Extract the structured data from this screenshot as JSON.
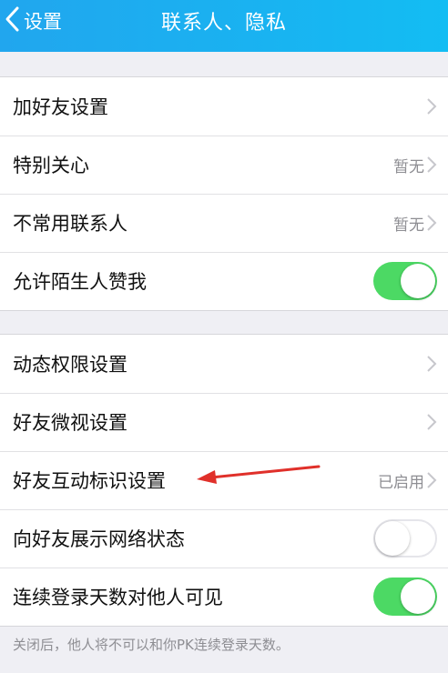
{
  "navbar": {
    "back_label": "设置",
    "title": "联系人、隐私"
  },
  "group1": [
    {
      "label": "加好友设置",
      "value": "",
      "type": "chevron"
    },
    {
      "label": "特别关心",
      "value": "暂无",
      "type": "chevron"
    },
    {
      "label": "不常用联系人",
      "value": "暂无",
      "type": "chevron"
    },
    {
      "label": "允许陌生人赞我",
      "value": "",
      "type": "toggle",
      "on": true
    }
  ],
  "group2": [
    {
      "label": "动态权限设置",
      "value": "",
      "type": "chevron"
    },
    {
      "label": "好友微视设置",
      "value": "",
      "type": "chevron"
    },
    {
      "label": "好友互动标识设置",
      "value": "已启用",
      "type": "chevron"
    },
    {
      "label": "向好友展示网络状态",
      "value": "",
      "type": "toggle",
      "on": false
    },
    {
      "label": "连续登录天数对他人可见",
      "value": "",
      "type": "toggle",
      "on": true
    }
  ],
  "footer_note": "关闭后，他人将不可以和你PK连续登录天数。",
  "colors": {
    "nav_start": "#21a6ee",
    "nav_end": "#13bdf3",
    "toggle_on": "#4cd964",
    "annotation_arrow": "#e0302a"
  }
}
